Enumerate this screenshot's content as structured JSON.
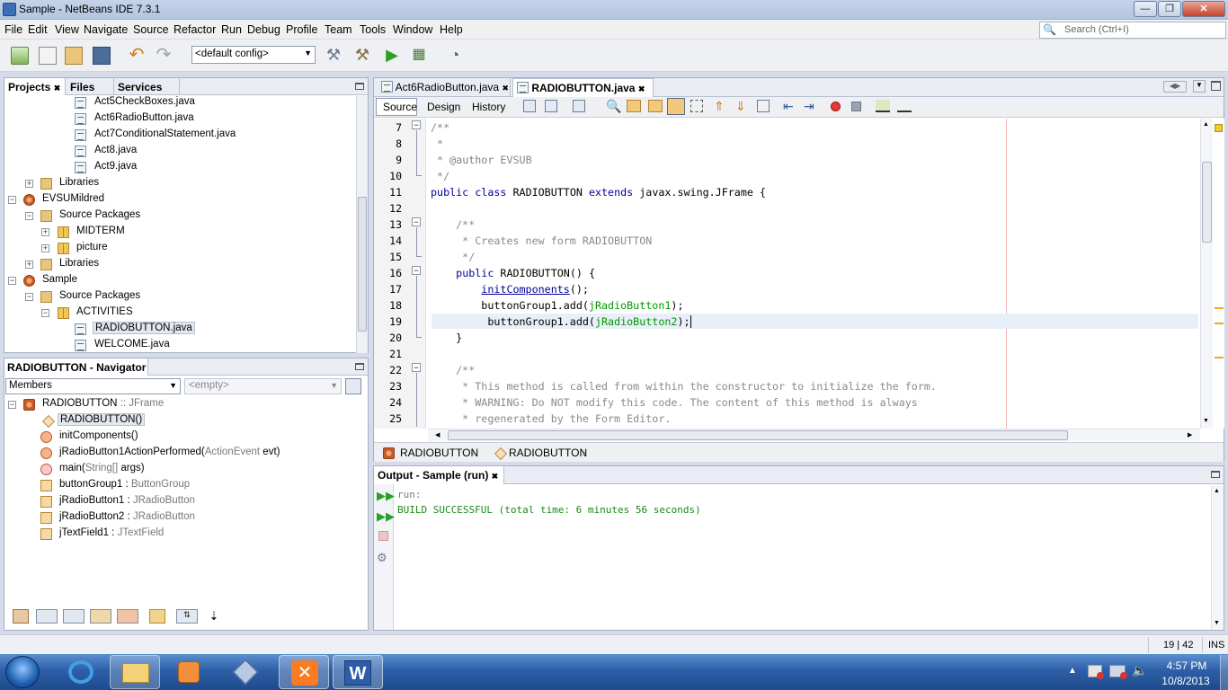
{
  "window": {
    "title": "Sample - NetBeans IDE 7.3.1",
    "min": "—",
    "max": "❐",
    "close": "✕"
  },
  "menu": [
    "File",
    "Edit",
    "View",
    "Navigate",
    "Source",
    "Refactor",
    "Run",
    "Debug",
    "Profile",
    "Team",
    "Tools",
    "Window",
    "Help"
  ],
  "search": {
    "placeholder": "Search (Ctrl+I)"
  },
  "toolbar": {
    "config": "<default config>"
  },
  "projects": {
    "tabs": [
      "Projects",
      "Files",
      "Services"
    ],
    "close": "✖",
    "tree": [
      {
        "label": "Act5CheckBoxes.java",
        "icon": "java-file-icon"
      },
      {
        "label": "Act6RadioButton.java",
        "icon": "java-file-icon"
      },
      {
        "label": "Act7ConditionalStatement.java",
        "icon": "java-file-icon"
      },
      {
        "label": "Act8.java",
        "icon": "java-file-icon"
      },
      {
        "label": "Act9.java",
        "icon": "java-file-icon"
      },
      {
        "label": "Libraries",
        "icon": "libraries-icon"
      },
      {
        "label": "EVSUMildred",
        "icon": "project-icon"
      },
      {
        "label": "Source Packages",
        "icon": "folder-icon"
      },
      {
        "label": "MIDTERM",
        "icon": "package-icon"
      },
      {
        "label": "picture",
        "icon": "package-icon"
      },
      {
        "label": "Libraries",
        "icon": "libraries-icon"
      },
      {
        "label": "Sample",
        "icon": "project-icon"
      },
      {
        "label": "Source Packages",
        "icon": "folder-icon"
      },
      {
        "label": "ACTIVITIES",
        "icon": "package-icon"
      },
      {
        "label": "RADIOBUTTON.java",
        "icon": "java-file-icon"
      },
      {
        "label": "WELCOME.java",
        "icon": "java-file-icon"
      }
    ]
  },
  "navigator": {
    "title": "RADIOBUTTON - Navigator",
    "members": "Members",
    "filter": "<empty>",
    "items": [
      {
        "name": "RADIOBUTTON",
        "type": " :: JFrame"
      },
      {
        "name": "RADIOBUTTON()",
        "type": ""
      },
      {
        "name": "initComponents()",
        "type": ""
      },
      {
        "name": "jRadioButton1ActionPerformed(",
        "type": "ActionEvent",
        "tail": " evt)"
      },
      {
        "name": "main(",
        "type": "String[]",
        "tail": " args)"
      },
      {
        "name": "buttonGroup1 : ",
        "type": "ButtonGroup"
      },
      {
        "name": "jRadioButton1 : ",
        "type": "JRadioButton"
      },
      {
        "name": "jRadioButton2 : ",
        "type": "JRadioButton"
      },
      {
        "name": "jTextField1 : ",
        "type": "JTextField"
      }
    ]
  },
  "editor": {
    "tabs": [
      "Act6RadioButton.java",
      "RADIOBUTTON.java"
    ],
    "views": [
      "Source",
      "Design",
      "History"
    ],
    "line_numbers": [
      "7",
      "8",
      "9",
      "10",
      "11",
      "12",
      "13",
      "14",
      "15",
      "16",
      "17",
      "18",
      "19",
      "20",
      "21",
      "22",
      "23",
      "24",
      "25"
    ],
    "breadcrumb": [
      "RADIOBUTTON",
      "RADIOBUTTON"
    ]
  },
  "output": {
    "title": "Output - Sample (run)",
    "lines": [
      "run:",
      "BUILD SUCCESSFUL (total time: 6 minutes 56 seconds)"
    ]
  },
  "status": {
    "position": "19 | 42",
    "mode": "INS"
  },
  "clock": {
    "time": "4:57 PM",
    "date": "10/8/2013"
  }
}
